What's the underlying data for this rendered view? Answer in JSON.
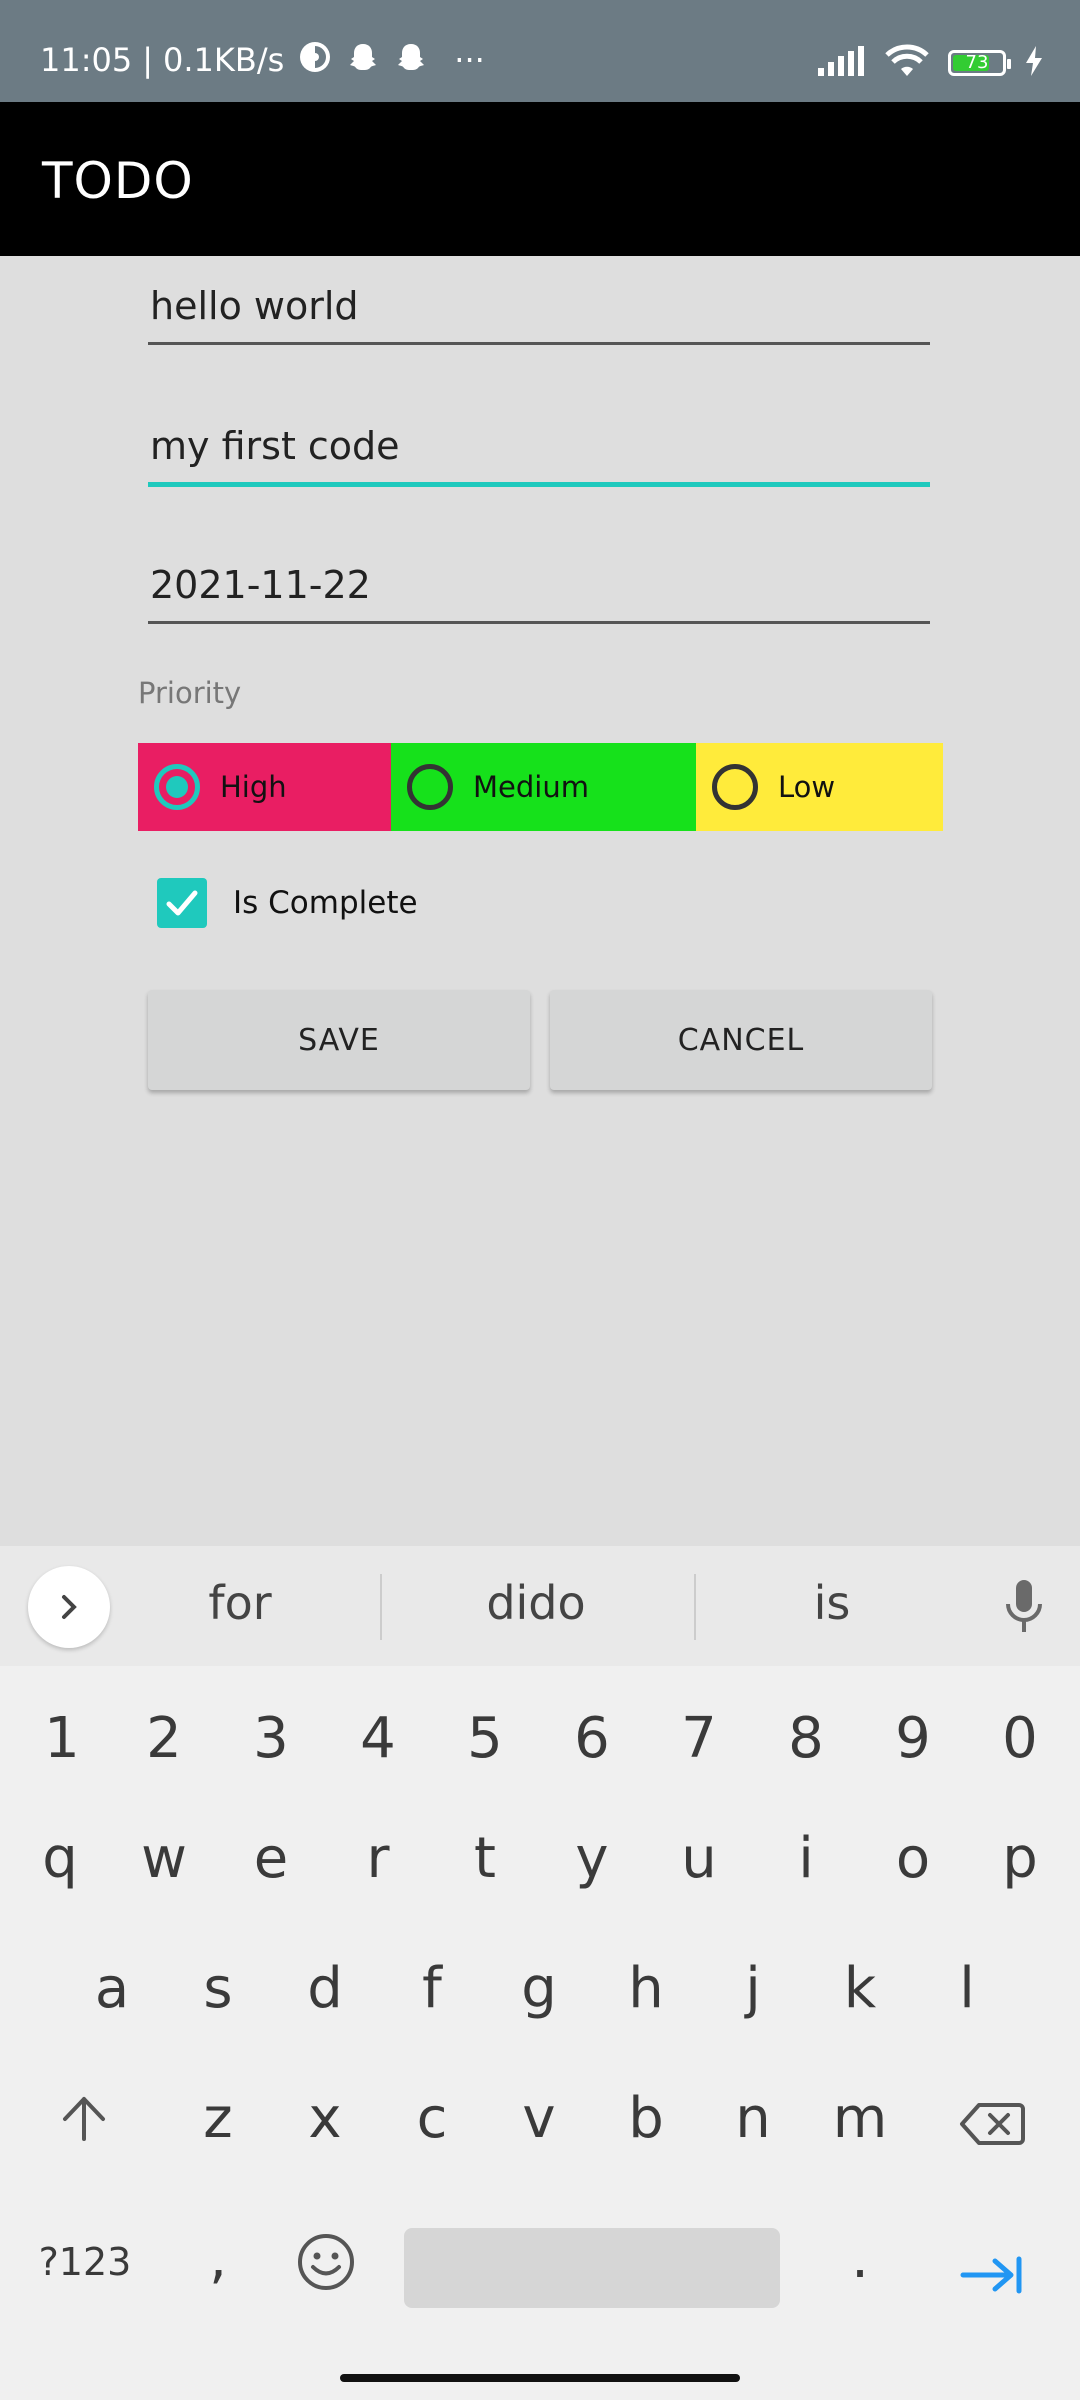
{
  "status_bar": {
    "time": "11:05",
    "separator": "|",
    "net_speed": "0.1KB/s",
    "more": "···",
    "battery": "73"
  },
  "app_bar": {
    "title": "TODO"
  },
  "form": {
    "title_value": "hello world",
    "description_value": "my first code",
    "date_value": "2021-11-22",
    "priority_label": "Priority",
    "priorities": [
      {
        "label": "High",
        "color": "#e91e63",
        "checked": true
      },
      {
        "label": "Medium",
        "color": "#16e11b",
        "checked": false
      },
      {
        "label": "Low",
        "color": "#ffeb3b",
        "checked": false
      }
    ],
    "complete_label": "Is Complete",
    "complete_checked": true,
    "save_label": "SAVE",
    "cancel_label": "CANCEL"
  },
  "colors": {
    "accent": "#1fc9bd",
    "status_bar": "#6c7b84",
    "app_bar": "#000000",
    "background": "#dedede"
  },
  "keyboard": {
    "suggestions": [
      "for",
      "dido",
      "is"
    ],
    "row_numbers": [
      "1",
      "2",
      "3",
      "4",
      "5",
      "6",
      "7",
      "8",
      "9",
      "0"
    ],
    "row_1": [
      "q",
      "w",
      "e",
      "r",
      "t",
      "y",
      "u",
      "i",
      "o",
      "p"
    ],
    "row_2": [
      "a",
      "s",
      "d",
      "f",
      "g",
      "h",
      "j",
      "k",
      "l"
    ],
    "row_3": [
      "z",
      "x",
      "c",
      "v",
      "b",
      "n",
      "m"
    ],
    "symbols_label": "?123",
    "comma": ",",
    "period": "."
  }
}
